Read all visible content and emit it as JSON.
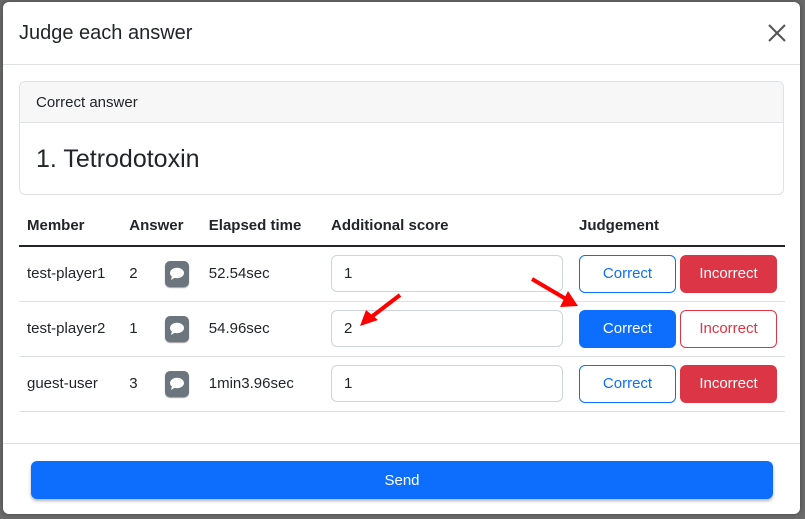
{
  "modal": {
    "title": "Judge each answer",
    "close_icon": "close-icon"
  },
  "correct_answer_card": {
    "header": "Correct answer",
    "answer": "1. Tetrodotoxin"
  },
  "table": {
    "headers": {
      "member": "Member",
      "answer": "Answer",
      "elapsed": "Elapsed time",
      "additional_score": "Additional score",
      "judgement": "Judgement"
    },
    "rows": [
      {
        "member": "test-player1",
        "answer": "2",
        "elapsed": "52.54sec",
        "score": "1",
        "correct_label": "Correct",
        "incorrect_label": "Incorrect",
        "selected": "incorrect"
      },
      {
        "member": "test-player2",
        "answer": "1",
        "elapsed": "54.96sec",
        "score": "2",
        "correct_label": "Correct",
        "incorrect_label": "Incorrect",
        "selected": "correct"
      },
      {
        "member": "guest-user",
        "answer": "3",
        "elapsed": "1min3.96sec",
        "score": "1",
        "correct_label": "Correct",
        "incorrect_label": "Incorrect",
        "selected": "incorrect"
      }
    ]
  },
  "footer": {
    "send_label": "Send"
  },
  "colors": {
    "primary": "#0d6efd",
    "danger": "#dc3545",
    "secondary": "#6c757d",
    "annotation_arrow": "#ff0000"
  },
  "icons": {
    "chat": "chat-bubble-icon"
  }
}
